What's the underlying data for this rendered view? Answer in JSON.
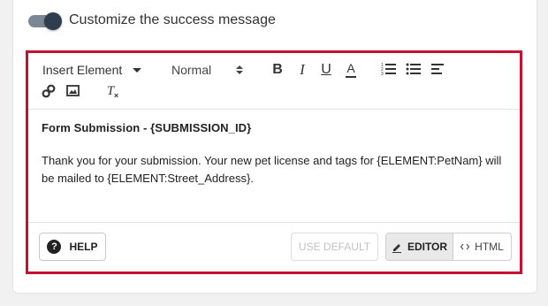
{
  "settings": {
    "toggle_label": "Customize the success message",
    "toggle_on": true
  },
  "toolbar": {
    "insert_element": "Insert Element",
    "text_size": "Normal",
    "bold": "B",
    "italic": "I",
    "underline": "U",
    "color": "A",
    "clear_format": "T"
  },
  "content": {
    "subject": "Form Submission - {SUBMISSION_ID}",
    "body": "Thank you for your submission. Your new pet license and tags for {ELEMENT:PetNam} will be mailed to {ELEMENT:Street_Address}."
  },
  "footer": {
    "help_label": "HELP",
    "help_icon": "?",
    "use_default_label": "USE DEFAULT",
    "editor_label": "EDITOR",
    "html_label": "HTML"
  },
  "colors": {
    "highlight_border": "#c8102e",
    "toggle_knob": "#2e3e4e",
    "toggle_track": "#7b8794"
  },
  "icons": {
    "link": "link-icon",
    "image": "image-icon",
    "ordered_list": "ordered-list-icon",
    "bulleted_list": "bulleted-list-icon",
    "align": "align-left-icon",
    "clear_format": "clear-format-icon",
    "help": "help-circle-icon",
    "editor": "pencil-icon",
    "html": "code-icon"
  }
}
